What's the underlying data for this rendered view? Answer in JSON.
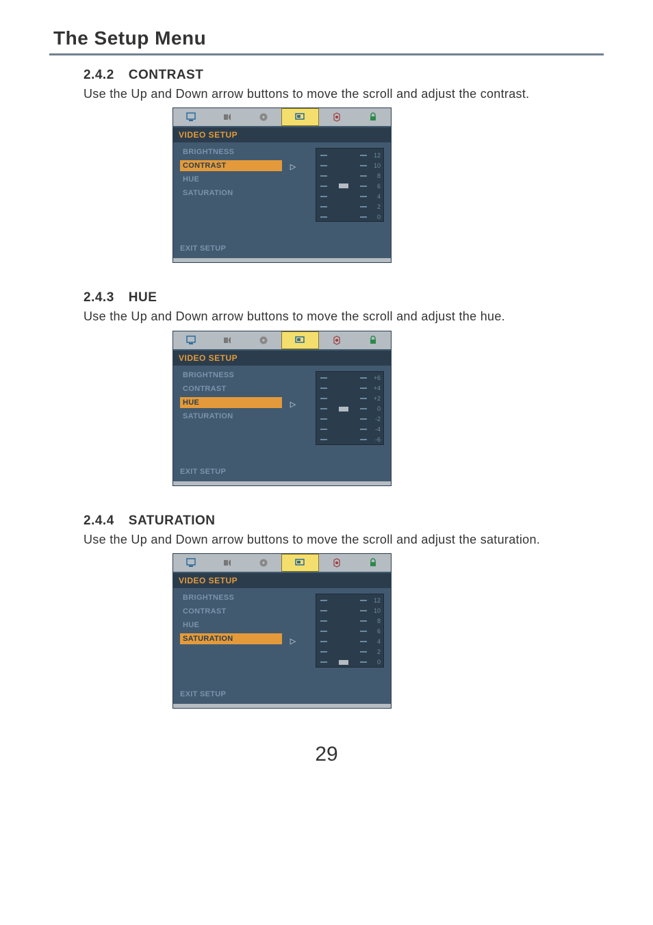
{
  "page_title": "The Setup Menu",
  "page_number": "29",
  "sections": {
    "contrast": {
      "num": "2.4.2",
      "heading": "CONTRAST",
      "body": "Use the Up and Down arrow buttons to move the scroll and adjust the contrast."
    },
    "hue": {
      "num": "2.4.3",
      "heading": "HUE",
      "body": "Use the Up and Down arrow buttons  to move the scroll and adjust the hue."
    },
    "saturation": {
      "num": "2.4.4",
      "heading": "SATURATION",
      "body": "Use the Up and Down arrow buttons  to move the scroll and adjust the saturation."
    }
  },
  "osd_common": {
    "title": "VIDEO SETUP",
    "brightness": "BRIGHTNESS",
    "contrast": "CONTRAST",
    "hue": "HUE",
    "saturation": "SATURATION",
    "exit": "EXIT SETUP"
  },
  "contrast_scale": [
    "12",
    "10",
    "8",
    "6",
    "4",
    "2",
    "0"
  ],
  "hue_scale": [
    "+6",
    "+4",
    "+2",
    "0",
    "-2",
    "-4",
    "-6"
  ],
  "saturation_scale": [
    "12",
    "10",
    "8",
    "6",
    "4",
    "2",
    "0"
  ],
  "tab_icons": [
    "monitor",
    "audio",
    "disc",
    "screen",
    "speaker",
    "lock"
  ]
}
